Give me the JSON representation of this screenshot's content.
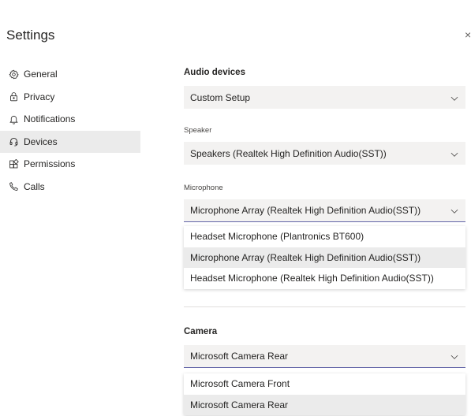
{
  "window": {
    "title": "Settings",
    "close_glyph": "×"
  },
  "sidebar": {
    "items": [
      {
        "label": "General",
        "icon": "gear-icon",
        "active": false
      },
      {
        "label": "Privacy",
        "icon": "lock-icon",
        "active": false
      },
      {
        "label": "Notifications",
        "icon": "bell-icon",
        "active": false
      },
      {
        "label": "Devices",
        "icon": "headset-icon",
        "active": true
      },
      {
        "label": "Permissions",
        "icon": "apps-icon",
        "active": false
      },
      {
        "label": "Calls",
        "icon": "phone-icon",
        "active": false
      }
    ]
  },
  "audio": {
    "section_title": "Audio devices",
    "device_value": "Custom Setup",
    "speaker_label": "Speaker",
    "speaker_value": "Speakers (Realtek High Definition Audio(SST))",
    "microphone_label": "Microphone",
    "microphone_value": "Microphone Array (Realtek High Definition Audio(SST))",
    "microphone_options": [
      "Headset Microphone (Plantronics BT600)",
      "Microphone Array (Realtek High Definition Audio(SST))",
      "Headset Microphone (Realtek High Definition Audio(SST))"
    ]
  },
  "camera": {
    "section_title": "Camera",
    "camera_value": "Microsoft Camera Rear",
    "camera_options": [
      "Microsoft Camera Front",
      "Microsoft Camera Rear"
    ]
  },
  "colors": {
    "accent": "#6264a7",
    "selected_bg": "#ebebeb",
    "field_bg": "#f3f2f1"
  }
}
